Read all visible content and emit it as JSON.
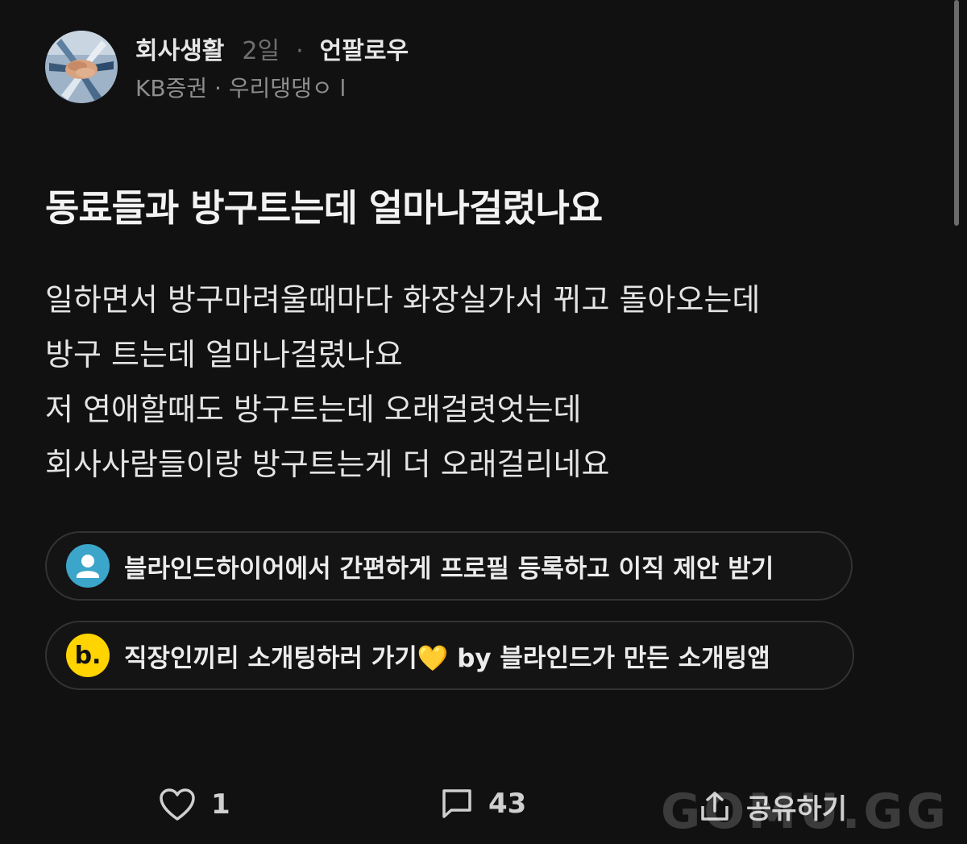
{
  "post": {
    "channel": "회사생활",
    "time_ago": "2일",
    "separator": "·",
    "unfollow_label": "언팔로우",
    "author_line": "KB증권 · 우리댕댕ㅇ l",
    "title": "동료들과 방구트는데 얼마나걸렸나요",
    "body_lines": [
      "일하면서 방구마려울때마다 화장실가서 뀌고 돌아오는데",
      "방구 트는데 얼마나걸렸나요",
      "저 연애할때도 방구트는데 오래걸렷엇는데",
      "회사사람들이랑 방구트는게 더 오래걸리네요"
    ]
  },
  "promos": [
    {
      "icon": "person-icon",
      "text": "블라인드하이어에서 간편하게 프로필 등록하고 이직 제안 받기"
    },
    {
      "icon": "b-logo-icon",
      "icon_letter": "b.",
      "text": "직장인끼리 소개팅하러 가기💛 by 블라인드가 만든 소개팅앱"
    }
  ],
  "actions": {
    "like_count": "1",
    "comment_count": "43",
    "share_label": "공유하기"
  },
  "watermark": "GOMU.GG",
  "colors": {
    "background": "#111111",
    "person_icon_bg": "#3ba6c9",
    "b_icon_bg": "#ffd400"
  }
}
